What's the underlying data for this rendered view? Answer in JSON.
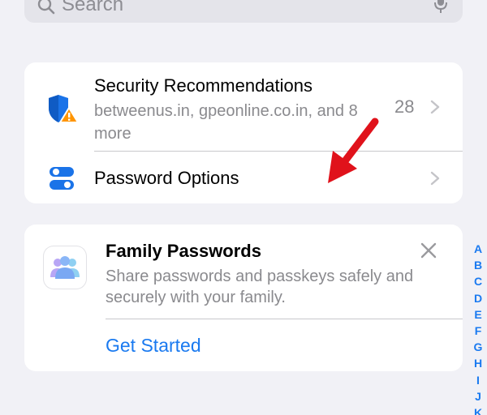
{
  "search": {
    "placeholder": "Search",
    "icon": "search-icon",
    "mic_icon": "microphone-icon"
  },
  "security_card": {
    "title": "Security Recommendations",
    "subtitle": "betweenus.in, gpeonline.co.in, and 8 more",
    "count": "28",
    "icon": "shield-warning-icon"
  },
  "password_options": {
    "label": "Password Options",
    "icon": "toggle-icon"
  },
  "family_card": {
    "title": "Family Passwords",
    "description": "Share passwords and passkeys safely and securely with your family.",
    "cta": "Get Started",
    "icon": "family-people-icon"
  },
  "index": {
    "letters": [
      "A",
      "B",
      "C",
      "D",
      "E",
      "F",
      "G",
      "H",
      "I",
      "J",
      "K"
    ]
  },
  "colors": {
    "accent": "#1a7af0",
    "shield_blue": "#1a73e8",
    "warning_orange": "#ff9500",
    "annotation_red": "#e0121b",
    "background": "#f1f1f6"
  }
}
